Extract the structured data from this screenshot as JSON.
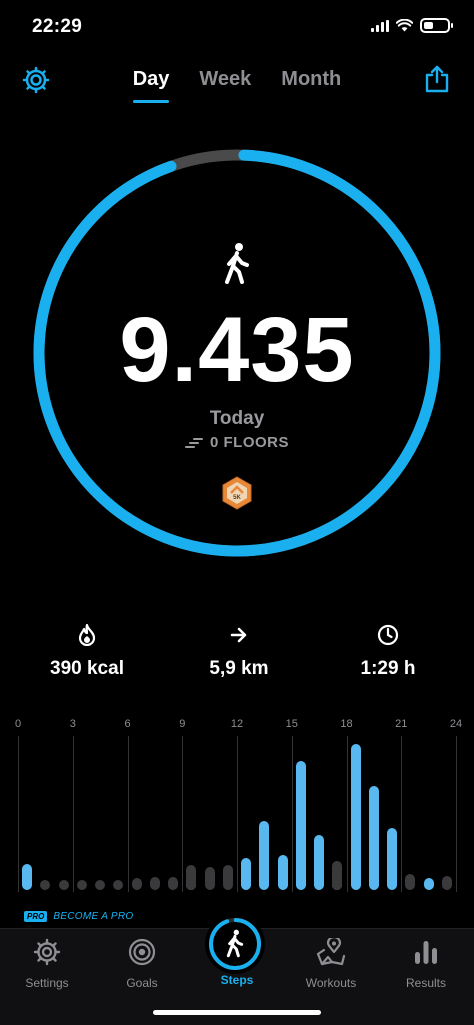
{
  "status_bar": {
    "time": "22:29"
  },
  "header": {
    "tabs": [
      {
        "label": "Day",
        "active": true
      },
      {
        "label": "Week",
        "active": false
      },
      {
        "label": "Month",
        "active": false
      }
    ],
    "settings_icon": "gear-icon",
    "share_icon": "share-icon"
  },
  "ring": {
    "progress_fraction": 0.94,
    "steps": "9.435",
    "period_label": "Today",
    "floors_label": "0 FLOORS",
    "badge_label": "5K",
    "accent": "#1ab0f0",
    "track": "#4a4a4a"
  },
  "stats": {
    "calories": "390 kcal",
    "distance": "5,9 km",
    "duration": "1:29 h"
  },
  "chart_data": {
    "type": "bar",
    "x_tick_labels": [
      "0",
      "3",
      "6",
      "9",
      "12",
      "15",
      "18",
      "21",
      "24"
    ],
    "hours": [
      0,
      1,
      2,
      3,
      4,
      5,
      6,
      7,
      8,
      9,
      10,
      11,
      12,
      13,
      14,
      15,
      16,
      17,
      18,
      19,
      20,
      21,
      22,
      23
    ],
    "series": [
      {
        "values": [
          480,
          0,
          0,
          0,
          0,
          0,
          0,
          0,
          0,
          210,
          0,
          0,
          590,
          1280,
          650,
          2410,
          1030,
          300,
          2730,
          1950,
          1160,
          0,
          230,
          0
        ]
      },
      {
        "values": [
          0,
          180,
          180,
          180,
          180,
          180,
          220,
          240,
          240,
          470,
          430,
          460,
          0,
          0,
          0,
          0,
          0,
          550,
          0,
          0,
          0,
          300,
          0,
          260
        ]
      }
    ],
    "colors": [
      "#5ab8f0",
      "#3a3a3c"
    ]
  },
  "promo": {
    "badge": "PRO",
    "text": "BECOME A PRO"
  },
  "tab_bar": {
    "items": [
      {
        "label": "Settings",
        "icon": "gear-icon"
      },
      {
        "label": "Goals",
        "icon": "target-icon"
      },
      {
        "label": "Steps",
        "icon": "walking-icon",
        "active": true
      },
      {
        "label": "Workouts",
        "icon": "map-pin-icon"
      },
      {
        "label": "Results",
        "icon": "bar-chart-icon"
      }
    ]
  }
}
